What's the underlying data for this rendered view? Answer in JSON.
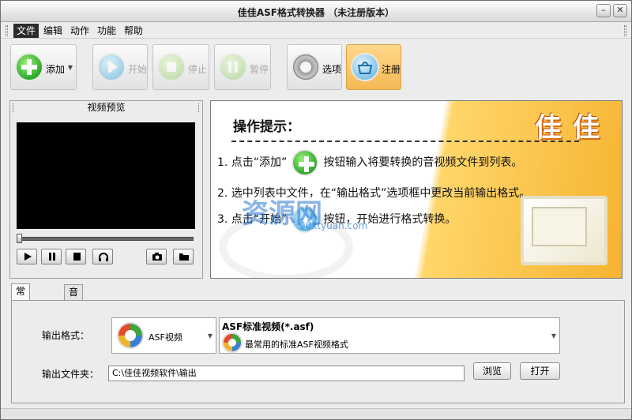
{
  "window": {
    "title": "佳佳ASF格式转换器  （未注册版本）"
  },
  "menu": {
    "items": [
      "文件",
      "编辑",
      "动作",
      "功能",
      "帮助"
    ]
  },
  "toolbar": {
    "add": "添加",
    "start": "开始",
    "stop": "停止",
    "pause": "暂停",
    "options": "选项",
    "register": "注册"
  },
  "preview": {
    "title": "视频预览"
  },
  "tips": {
    "heading": "操作提示：",
    "brand": "佳佳",
    "line1_a": "1. 点击“添加”",
    "line1_b": "按钮输入将要转换的音视频文件到列表。",
    "line2": "2. 选中列表中文件，在“输出格式”选项框中更改当前输出格式。",
    "line3_a": "3. 点击“开始”",
    "line3_b": "按钮，开始进行格式转换。"
  },
  "watermark": {
    "text": "资源网",
    "url": "90xtyuan.com"
  },
  "tabs": [
    "常规设置",
    "音视频高级设置"
  ],
  "settings": {
    "format_label": "输出格式：",
    "format_value": "ASF视频",
    "format_detail_title": "ASF标准视频(*.asf)",
    "format_detail_desc": "最常用的标准ASF视频格式",
    "folder_label": "输出文件夹：",
    "folder_value": "C:\\佳佳视频软件\\输出",
    "browse": "浏览",
    "open": "打开"
  }
}
